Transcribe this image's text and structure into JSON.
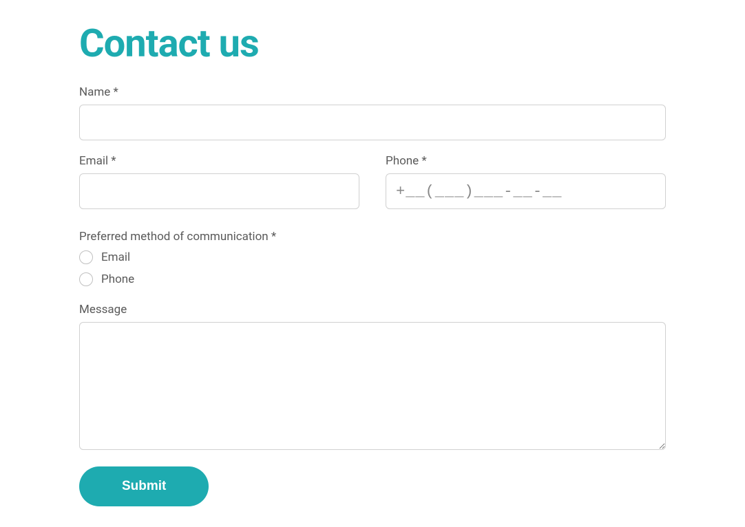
{
  "title": "Contact us",
  "fields": {
    "name": {
      "label": "Name *",
      "value": ""
    },
    "email": {
      "label": "Email *",
      "value": ""
    },
    "phone": {
      "label": "Phone *",
      "value": "",
      "placeholder": "+__(___)___-__-__"
    },
    "message": {
      "label": "Message",
      "value": ""
    }
  },
  "preferred": {
    "legend": "Preferred method of communication *",
    "options": {
      "email": "Email",
      "phone": "Phone"
    }
  },
  "submit": {
    "label": "Submit"
  }
}
